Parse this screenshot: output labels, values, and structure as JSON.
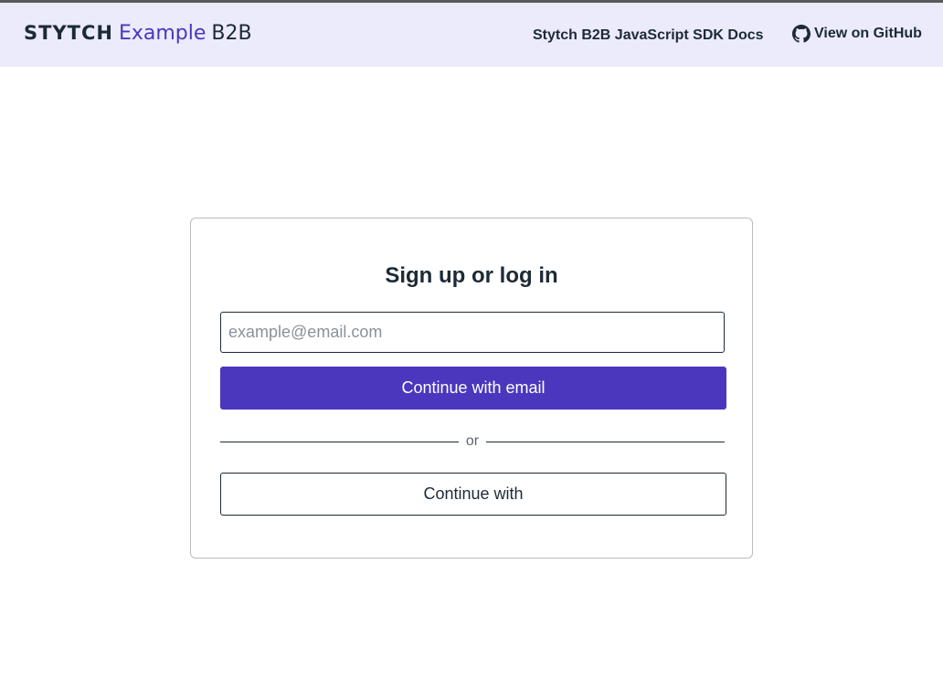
{
  "header": {
    "brand": {
      "stytch": "STYTCH",
      "example": "Example",
      "b2b": "B2B"
    },
    "nav": {
      "docs_label": "Stytch B2B JavaScript SDK Docs",
      "github_label": "View on GitHub",
      "github_icon": "github-icon"
    },
    "background": "#ebebfc"
  },
  "login": {
    "title": "Sign up or log in",
    "email_placeholder": "example@email.com",
    "email_value": "",
    "continue_email_label": "Continue with email",
    "divider_text": "or",
    "continue_with_label": "Continue with"
  },
  "colors": {
    "primary": "#4a37be",
    "text": "#1d2a36",
    "border": "#b8bcc2"
  }
}
